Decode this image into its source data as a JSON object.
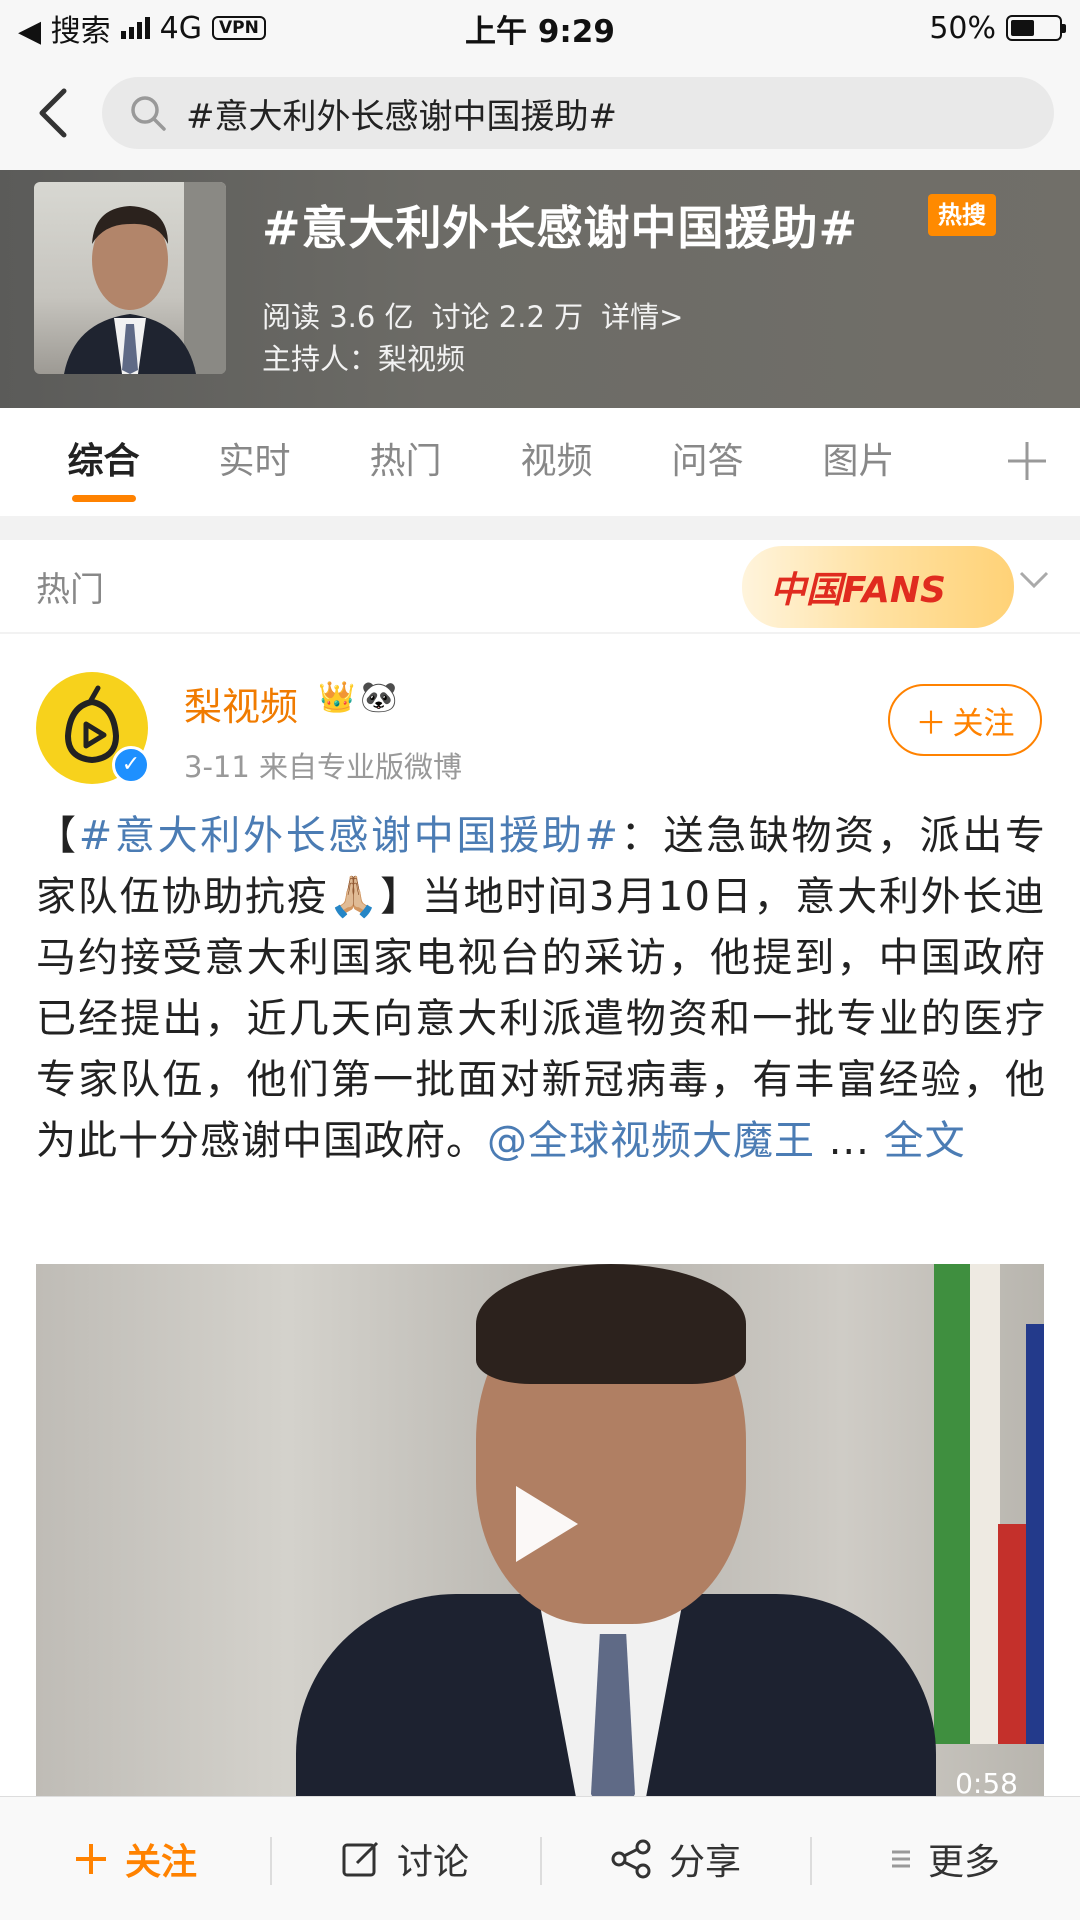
{
  "status_bar": {
    "back_app": "◀ 搜索",
    "network": "4G",
    "vpn": "VPN",
    "time": "上午 9:29",
    "battery": "50%",
    "battery_level": 0.5
  },
  "search": {
    "query": "#意大利外长感谢中国援助#"
  },
  "topic": {
    "title": "#意大利外长感谢中国援助#",
    "hot_tag": "热搜",
    "reads": "阅读 3.6 亿",
    "discussions": "讨论 2.2 万",
    "details": "详情>",
    "host": "主持人：梨视频"
  },
  "tabs": [
    {
      "label": "综合",
      "active": true
    },
    {
      "label": "实时",
      "active": false
    },
    {
      "label": "热门",
      "active": false
    },
    {
      "label": "视频",
      "active": false
    },
    {
      "label": "问答",
      "active": false
    },
    {
      "label": "图片",
      "active": false
    }
  ],
  "section": {
    "title": "热门",
    "fans_badge": "中国FANS"
  },
  "post": {
    "author": "梨视频",
    "meta": "3-11  来自专业版微博",
    "follow_label": "关注",
    "body_open": "【",
    "hashtag": "#意大利外长感谢中国援助#",
    "body_part1": "：送急缺物资，派出专家队伍协助抗疫",
    "emoji": "🙏🏼",
    "body_part2": "】当地时间3月10日，意大利外长迪马约接受意大利国家电视台的采访，他提到，中国政府已经提出，近几天向意大利派遣物资和一批专业的医疗专家队伍，他们第一批面对新冠病毒，有丰富经验，他为此十分感谢中国政府。",
    "mention": "@全球视频大魔王",
    "ellipsis": " ... ",
    "full_text": "全文",
    "video_duration": "0:58"
  },
  "bottom_bar": {
    "follow": "关注",
    "discuss": "讨论",
    "share": "分享",
    "more": "更多"
  },
  "colors": {
    "accent": "#ff8200",
    "link": "#4b7cb4",
    "verified": "#1e90ff"
  }
}
